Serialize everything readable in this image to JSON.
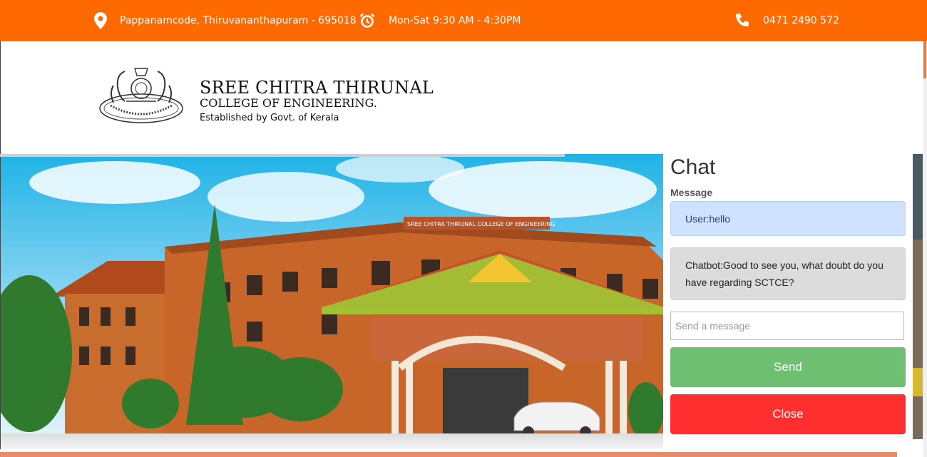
{
  "topbar": {
    "address": "Pappanamcode, Thiruvananthapuram - 695018",
    "hours": "Mon-Sat 9:30 AM - 4:30PM",
    "phone": "0471 2490 572",
    "icons": [
      "location-pin-icon",
      "alarm-clock-icon",
      "phone-icon"
    ],
    "color": "#ff6a00"
  },
  "brand": {
    "line1": "SREE CHITRA THIRUNAL",
    "line2": "COLLEGE OF ENGINEERING.",
    "line3": "Established by Govt. of Kerala",
    "emblem_text": "SREE CHITRA THIRUNAL COLLEGE OF ENGINEERING"
  },
  "hero": {
    "building_sign": "SREE CHITRA THIRUNAL COLLEGE OF ENGINEERING"
  },
  "chat": {
    "title": "Chat",
    "message_label": "Message",
    "messages": [
      {
        "text": "User:hello"
      },
      {
        "text": "Chatbot:Good to see you, what doubt do you have regarding SCTCE?"
      }
    ],
    "input_placeholder": "Send a message",
    "send_label": "Send",
    "close_label": "Close",
    "send_color": "#6fbf73",
    "close_color": "#ff2f2f"
  }
}
